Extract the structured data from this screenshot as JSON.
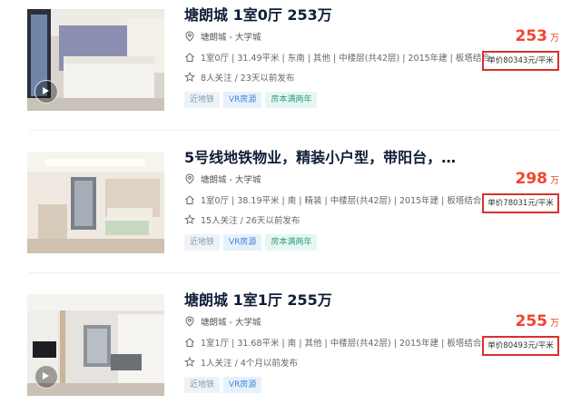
{
  "listings": [
    {
      "title": "塘朗城 1室0厅 253万",
      "position": "塘朗城 - 大学城",
      "info": "1室0厅 | 31.49平米 | 东南 | 其他 | 中楼层(共42层) | 2015年建 | 板塔结合",
      "follow": "8人关注 / 23天以前发布",
      "tags": [
        "近地铁",
        "VR房源",
        "房本满两年"
      ],
      "total_price": "253",
      "total_unit": "万",
      "unit_price": "单价80343元/平米"
    },
    {
      "title": "5号线地铁物业，精装小户型，带阳台，…",
      "position": "塘朗城 - 大学城",
      "info": "1室0厅 | 38.19平米 | 南 | 精装 | 中楼层(共42层) | 2015年建 | 板塔结合",
      "follow": "15人关注 / 26天以前发布",
      "tags": [
        "近地铁",
        "VR房源",
        "房本满两年"
      ],
      "total_price": "298",
      "total_unit": "万",
      "unit_price": "单价78031元/平米"
    },
    {
      "title": "塘朗城 1室1厅 255万",
      "position": "塘朗城 - 大学城",
      "info": "1室1厅 | 31.68平米 | 南 | 其他 | 中楼层(共42层) | 2015年建 | 板塔结合",
      "follow": "1人关注 / 4个月以前发布",
      "tags": [
        "近地铁",
        "VR房源"
      ],
      "total_price": "255",
      "total_unit": "万",
      "unit_price": "单价80493元/平米"
    }
  ],
  "icons": {
    "position": "location-pin-icon",
    "info": "house-icon",
    "follow": "star-icon",
    "vr": "vr-play-icon"
  },
  "colors": {
    "price": "#f2442c",
    "highlight_box": "#d92f2f",
    "title": "#101d37"
  }
}
